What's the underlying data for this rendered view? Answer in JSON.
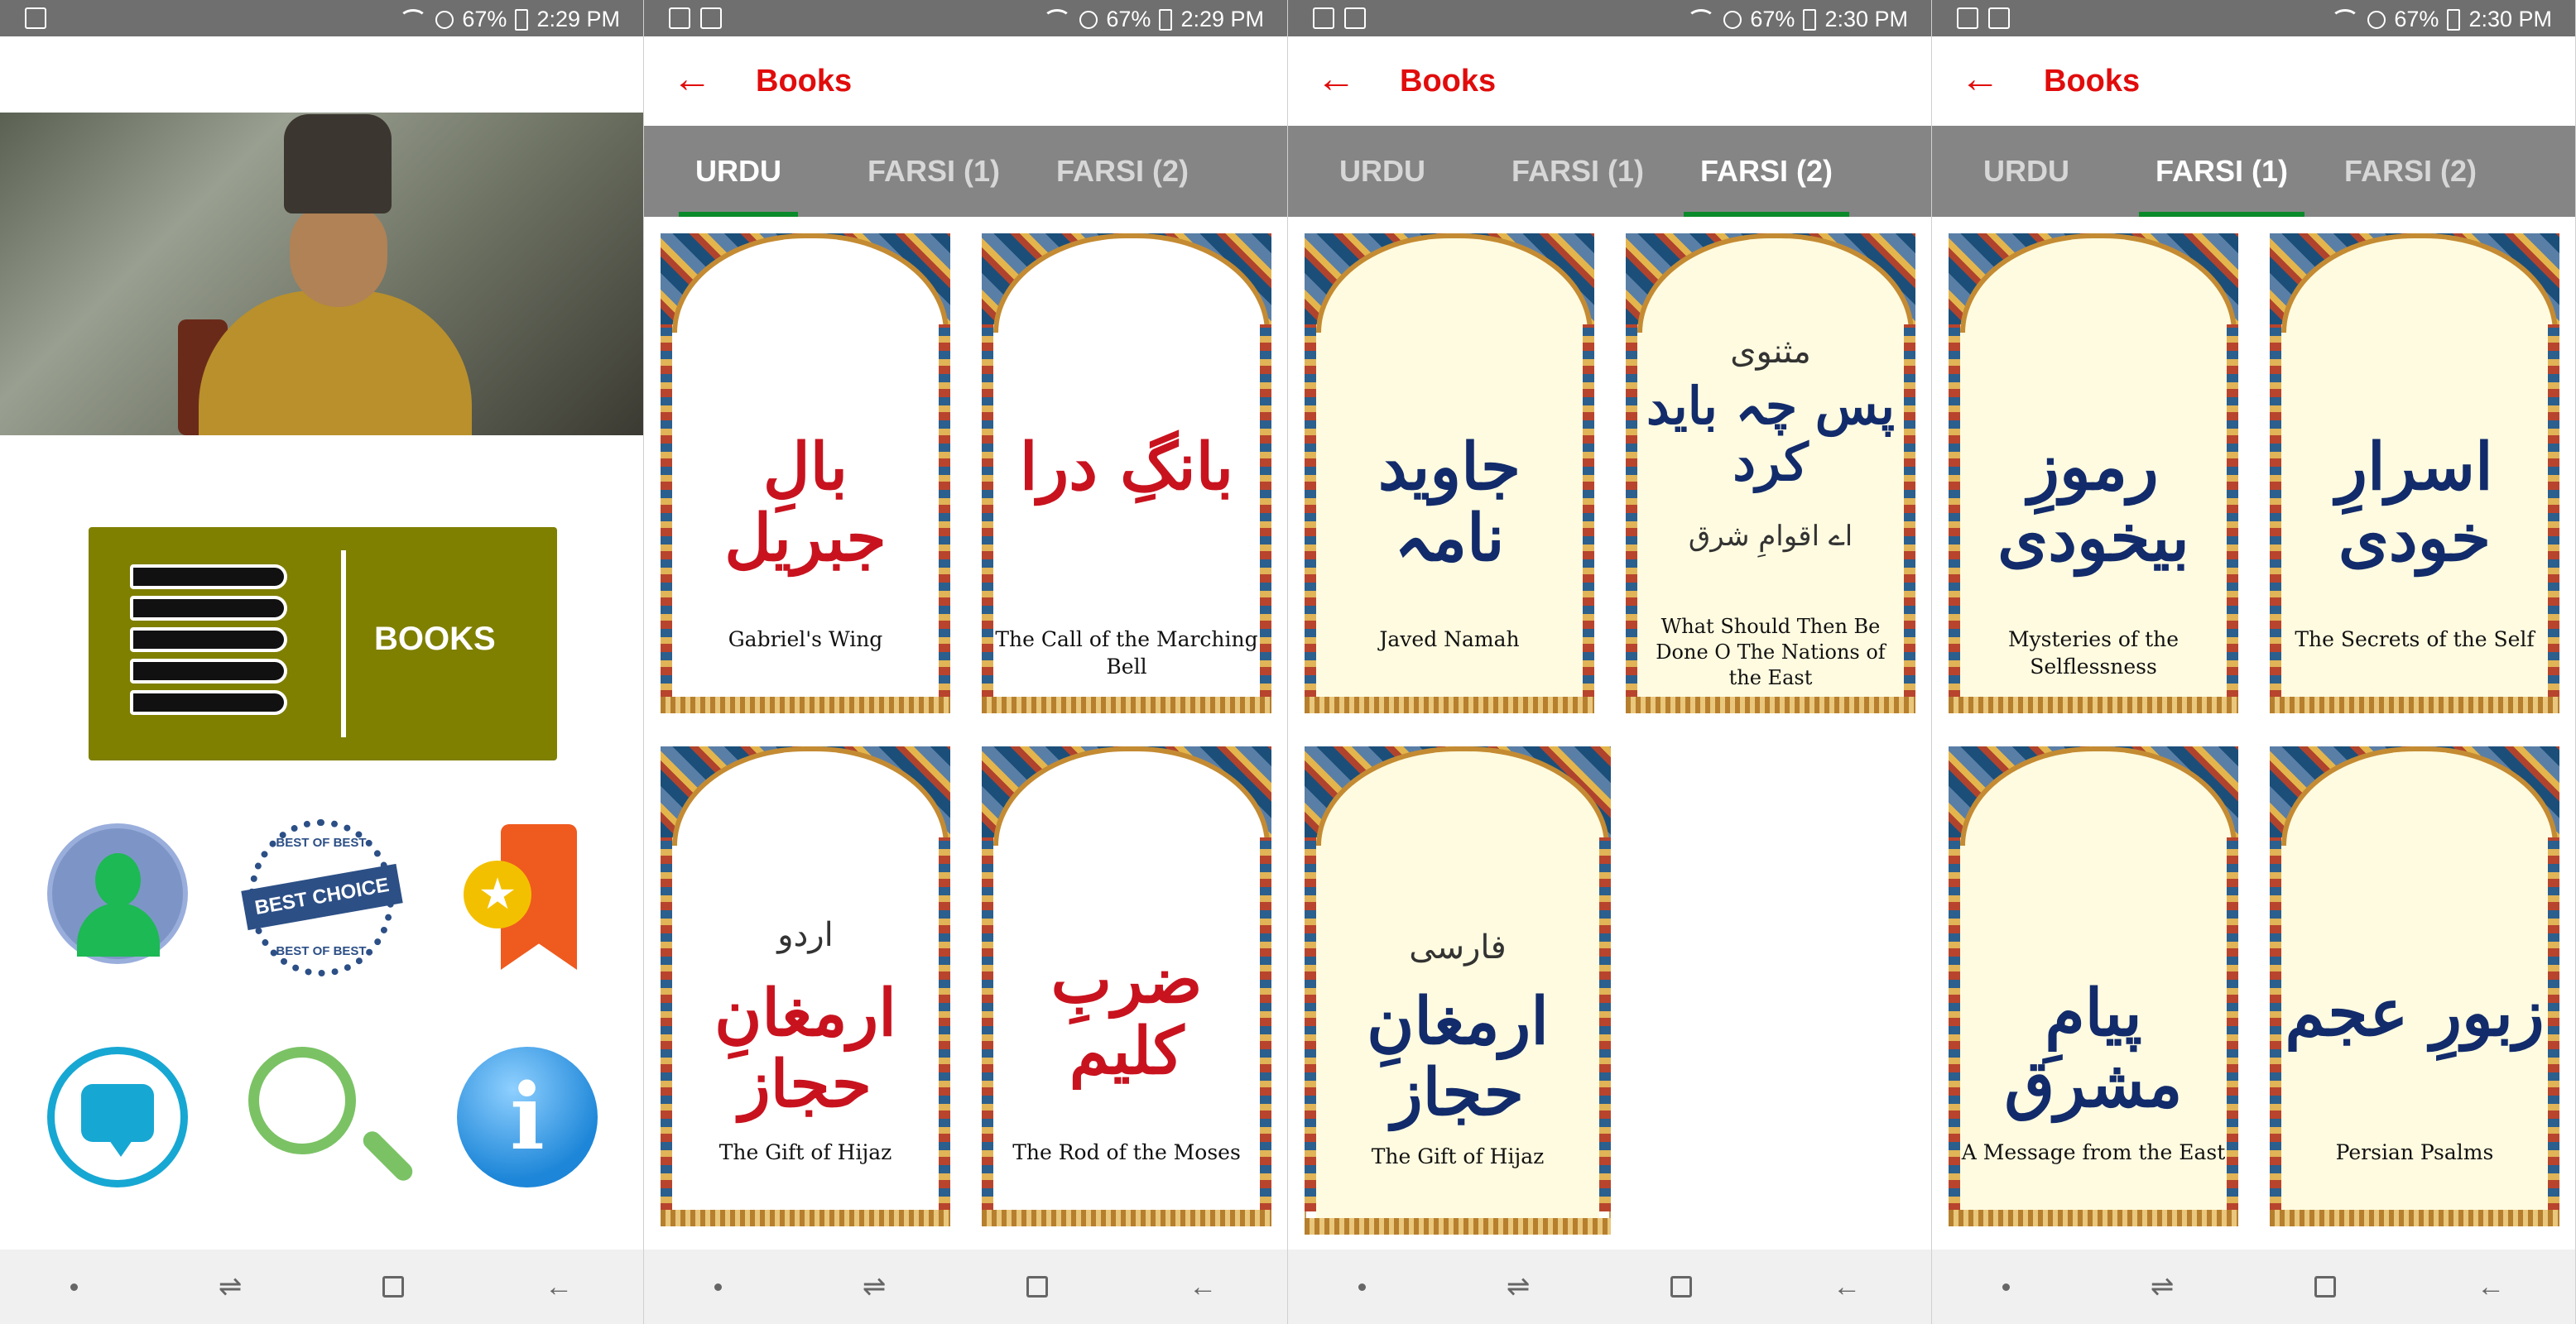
{
  "screens": [
    {
      "status": {
        "battery": "67%",
        "time": "2:29 PM"
      },
      "home": {
        "books_label": "BOOKS",
        "badge_top": "BEST OF BEST",
        "badge_main": "BEST CHOICE",
        "badge_bottom": "BEST OF BEST"
      }
    },
    {
      "status": {
        "battery": "67%",
        "time": "2:29 PM"
      },
      "title": "Books",
      "tabs": [
        "URDU",
        "FARSI (1)",
        "FARSI (2)"
      ],
      "active_tab": "URDU",
      "books": [
        {
          "urdu": "بالِ جبریل",
          "english": "Gabriel's Wing"
        },
        {
          "urdu": "بانگِ درا",
          "english": "The Call of the Marching Bell"
        },
        {
          "prefix": "اردو",
          "urdu": "ارمغانِ حجاز",
          "english": "The Gift of Hijaz"
        },
        {
          "urdu": "ضربِ کلیم",
          "english": "The Rod of the Moses"
        }
      ]
    },
    {
      "status": {
        "battery": "67%",
        "time": "2:30 PM"
      },
      "title": "Books",
      "tabs": [
        "URDU",
        "FARSI (1)",
        "FARSI (2)"
      ],
      "active_tab": "FARSI (2)",
      "books": [
        {
          "urdu": "جاوید نامہ",
          "english": "Javed Namah"
        },
        {
          "prefix": "مثنوی",
          "urdu": "پس چہ باید کرد",
          "subtitle": "اے اقوامِ شرق",
          "english": "What Should Then Be Done O The Nations of the East"
        },
        {
          "prefix": "فارسی",
          "urdu": "ارمغانِ حجاز",
          "english": "The Gift of Hijaz"
        }
      ]
    },
    {
      "status": {
        "battery": "67%",
        "time": "2:30 PM"
      },
      "title": "Books",
      "tabs": [
        "URDU",
        "FARSI (1)",
        "FARSI (2)"
      ],
      "active_tab": "FARSI (1)",
      "books": [
        {
          "urdu": "رموزِ بیخودی",
          "english": "Mysteries of the Selflessness"
        },
        {
          "urdu": "اسرارِ خودی",
          "english": "The Secrets of the Self"
        },
        {
          "urdu": "پیامِ مشرق",
          "english": "A Message from the East"
        },
        {
          "urdu": "زبورِ عجم",
          "english": "Persian Psalms"
        }
      ]
    }
  ],
  "colors": {
    "accent": "#e10c0c",
    "toolbar": "#858585",
    "tab_indicator": "#0a8a2a",
    "books_button": "#7f7f00",
    "urdu_red": "#c8131f",
    "urdu_blue": "#122b6b"
  }
}
